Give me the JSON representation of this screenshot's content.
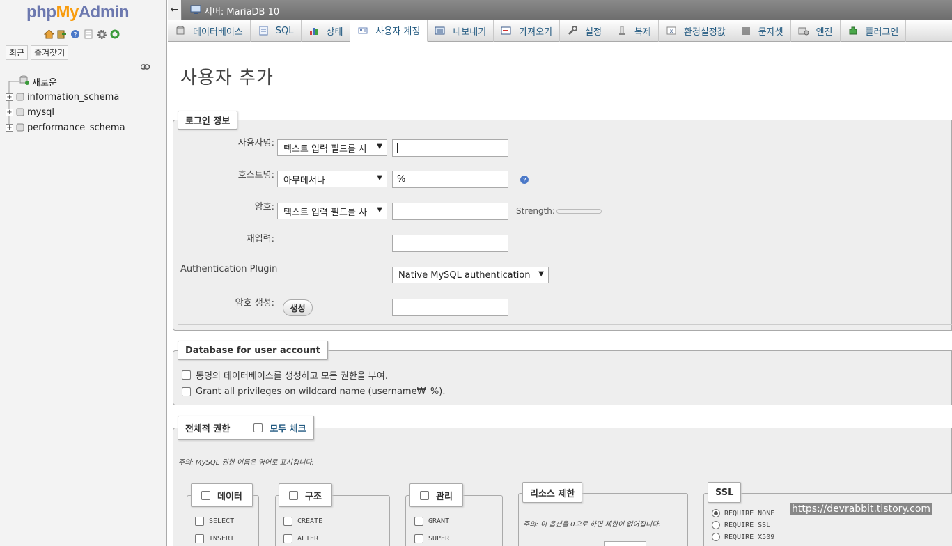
{
  "sidebar": {
    "logo_php": "php",
    "logo_my": "My",
    "logo_admin": "Admin",
    "recent_label": "최근",
    "favorites_label": "즐겨찾기",
    "tree": [
      {
        "label": "새로운",
        "type": "new"
      },
      {
        "label": "information_schema",
        "type": "db"
      },
      {
        "label": "mysql",
        "type": "db"
      },
      {
        "label": "performance_schema",
        "type": "db"
      }
    ]
  },
  "topbar": {
    "back_glyph": "←",
    "server_label": "서버: MariaDB 10"
  },
  "tabs": [
    {
      "label": "데이터베이스",
      "icon": "database-icon"
    },
    {
      "label": "SQL",
      "icon": "sql-icon"
    },
    {
      "label": "상태",
      "icon": "status-icon"
    },
    {
      "label": "사용자 계정",
      "icon": "users-icon"
    },
    {
      "label": "내보내기",
      "icon": "export-icon"
    },
    {
      "label": "가져오기",
      "icon": "import-icon"
    },
    {
      "label": "설정",
      "icon": "settings-icon"
    },
    {
      "label": "복제",
      "icon": "replication-icon"
    },
    {
      "label": "환경설정값",
      "icon": "variables-icon"
    },
    {
      "label": "문자셋",
      "icon": "charset-icon"
    },
    {
      "label": "엔진",
      "icon": "engine-icon"
    },
    {
      "label": "플러그인",
      "icon": "plugin-icon"
    }
  ],
  "active_tab": "사용자 계정",
  "page_title": "사용자 추가",
  "login": {
    "legend": "로그인 정보",
    "username_label": "사용자명:",
    "username_select": "텍스트 입력 필드를 사",
    "username_value": "",
    "host_label": "호스트명:",
    "host_select": "아무데서나",
    "host_value": "%",
    "password_label": "암호:",
    "password_select": "텍스트 입력 필드를 사",
    "strength_label": "Strength:",
    "retype_label": "재입력:",
    "auth_plugin_label": "Authentication Plugin",
    "auth_plugin_value": "Native MySQL authentication",
    "generate_label": "암호 생성:",
    "generate_button": "생성"
  },
  "database_section": {
    "legend": "Database for user account",
    "opt1": "동명의 데이터베이스를 생성하고 모든 권한을 부여.",
    "opt2": "Grant all privileges on wildcard name (username₩_%)."
  },
  "global_privs": {
    "legend": "전체적 권한",
    "check_all": "모두 체크",
    "note": "주의: MySQL 권한 이름은 영어로 표시됩니다.",
    "data_legend": "데이터",
    "data_items": [
      "SELECT",
      "INSERT"
    ],
    "structure_legend": "구조",
    "structure_items": [
      "CREATE",
      "ALTER"
    ],
    "admin_legend": "관리",
    "admin_items": [
      "GRANT",
      "SUPER"
    ],
    "resource_legend": "리소스 제한",
    "resource_note": "주의: 이 옵션을 0으로 하면 제한이 없어집니다.",
    "ssl_legend": "SSL",
    "ssl_options": [
      "REQUIRE NONE",
      "REQUIRE SSL",
      "REQUIRE X509"
    ]
  },
  "watermark": "https://devrabbit.tistory.com"
}
